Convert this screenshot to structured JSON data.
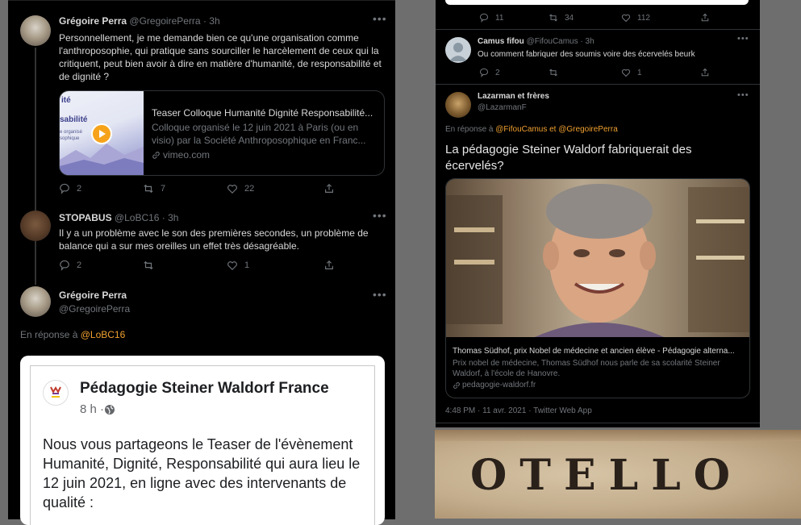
{
  "left": {
    "tweet1": {
      "name": "Grégoire Perra",
      "handle_time": "@GregoirePerra · 3h",
      "text": "Personnellement, je me demande bien ce qu'une organisation comme l'anthroposophie, qui pratique sans sourciller le harcèlement de ceux qui la critiquent, peut bien avoir à dire en matière d'humanité, de responsabilité et de dignité ?",
      "card": {
        "thumb_title": "ité",
        "thumb_word": "sabilité",
        "thumb_sub1": "e organisé",
        "thumb_sub2": "sophique",
        "title": "Teaser Colloque Humanité Dignité Responsabilité...",
        "desc": "Colloque organisé le 12 juin 2021 à Paris (ou en visio) par la Société Anthroposophique en Franc...",
        "domain": "vimeo.com"
      },
      "replies": "2",
      "retweets": "7",
      "likes": "22"
    },
    "tweet2": {
      "name": "STOPABUS",
      "handle_time": "@LoBC16 · 3h",
      "text": "Il y a un problème avec le son des premières secondes, un problème de balance qui a sur mes oreilles un effet très désagréable.",
      "replies": "2",
      "retweets": "",
      "likes": "1"
    },
    "tweet3": {
      "name": "Grégoire Perra",
      "handle": "@GregoirePerra",
      "reply_prefix": "En réponse à",
      "reply_to": "@LoBC16",
      "fb": {
        "page_name": "Pédagogie Steiner Waldorf France",
        "time": "8 h · ",
        "text": "Nous vous partageons le Teaser de l'évènement Humanité, Dignité, Responsabilité qui aura lieu le 12 juin 2021, en ligne avec des intervenants de qualité :"
      }
    }
  },
  "right": {
    "top_actions": {
      "replies": "11",
      "retweets": "34",
      "likes": "112"
    },
    "tweet_camus": {
      "name": "Camus fifou",
      "handle_time": "@FifouCamus · 3h",
      "text": "Ou comment fabriquer des soumis voire des écervelés beurk",
      "replies": "2",
      "retweets": "",
      "likes": "1"
    },
    "tweet_laz": {
      "name": "Lazarman et frères",
      "handle": "@LazarmanF",
      "reply_prefix": "En réponse à",
      "reply_to1": "@FifouCamus",
      "reply_and": "et",
      "reply_to2": "@GregoirePerra",
      "text": "La pédagogie Steiner Waldorf fabriquerait des écervelés?",
      "card": {
        "title": "Thomas Südhof, prix Nobel de médecine et ancien élève - Pédagogie alterna...",
        "desc": "Prix nobel de médecine, Thomas Südhof nous parle de sa scolarité Steiner Waldorf, à l'école de Hanovre.",
        "domain": "pedagogie-waldorf.fr"
      },
      "meta": "4:48 PM · 11 avr. 2021 · Twitter Web App"
    }
  },
  "otello": {
    "text": "OTELLO"
  },
  "icons": [
    "more-icon",
    "reply-icon",
    "retweet-icon",
    "like-icon",
    "share-icon",
    "play-icon",
    "link-icon",
    "globe-icon",
    "default-avatar-icon"
  ],
  "colors": {
    "accent": "#f0a030",
    "muted": "#71767b",
    "background": "#000000",
    "otello_paper": "#c9b598"
  }
}
